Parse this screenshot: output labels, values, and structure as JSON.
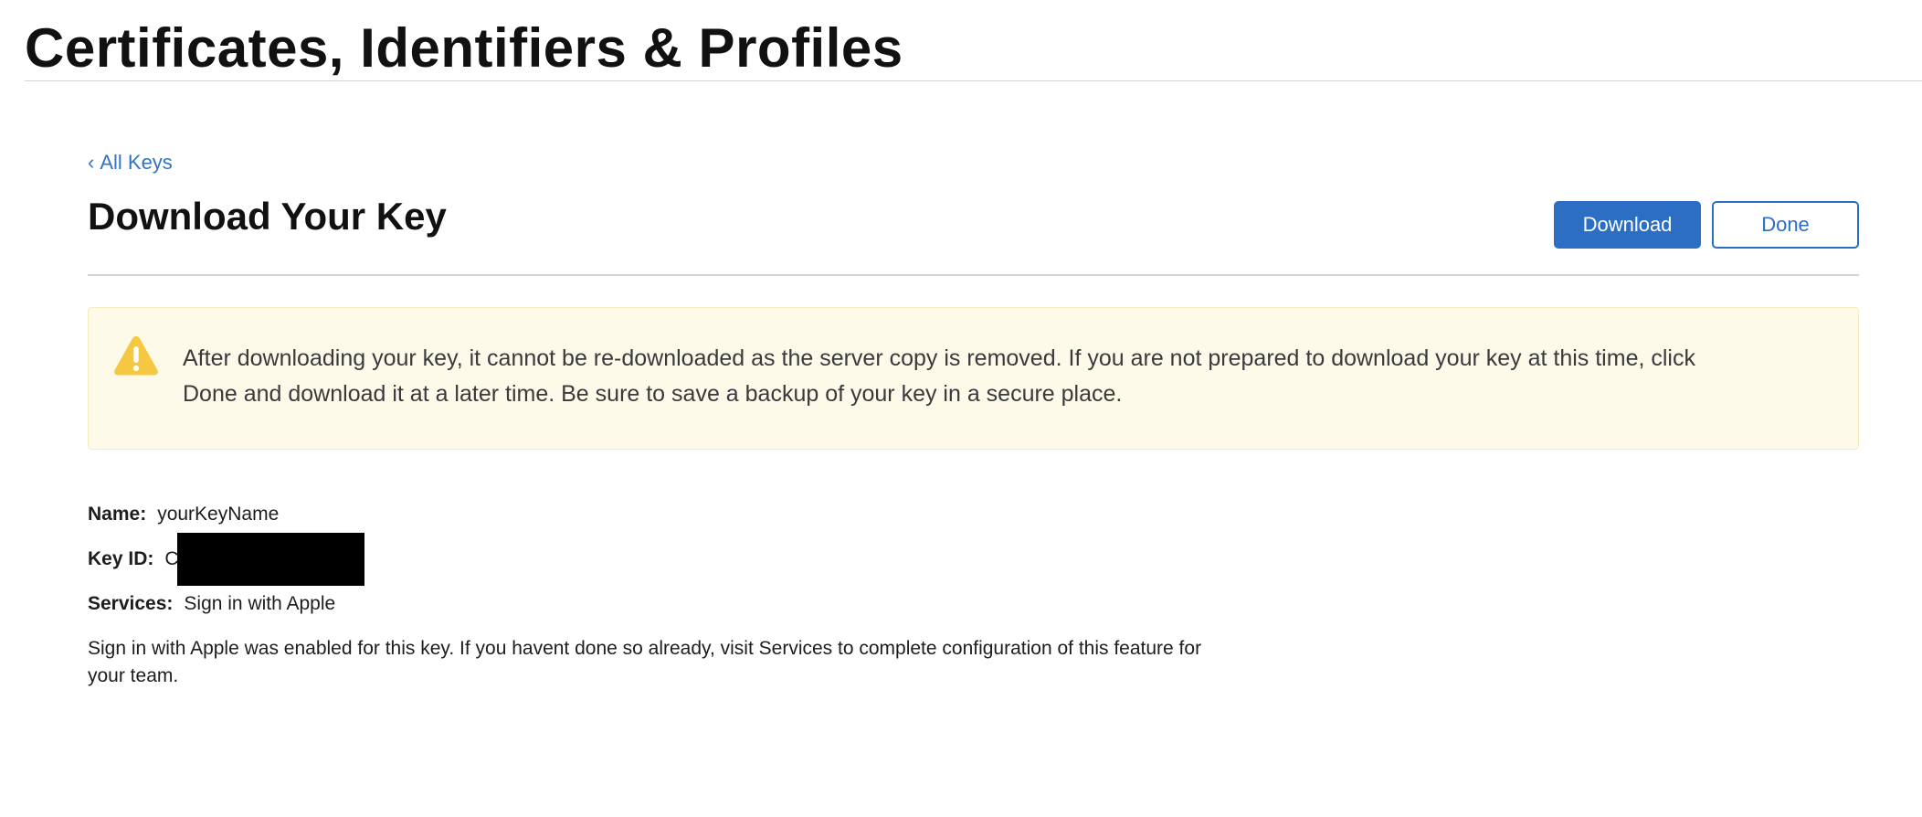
{
  "header": {
    "title": "Certificates, Identifiers & Profiles"
  },
  "nav": {
    "back_chevron": "‹",
    "back_label": "All Keys"
  },
  "page": {
    "title": "Download Your Key"
  },
  "actions": {
    "download_label": "Download",
    "done_label": "Done"
  },
  "warning": {
    "icon": "warning-triangle-icon",
    "text": "After downloading your key, it cannot be re-downloaded as the server copy is removed. If you are not prepared to download your key at this time, click Done and download it at a later time. Be sure to save a backup of your key in a secure place."
  },
  "details": {
    "name_label": "Name:",
    "name_value": "yourKeyName",
    "key_id_label": "Key ID:",
    "key_id_partial": "C",
    "services_label": "Services:",
    "services_value": "Sign in with Apple",
    "note": "Sign in with Apple was enabled for this key. If you havent done so already, visit Services to complete configuration of this feature for your team."
  },
  "colors": {
    "accent": "#2c6ec4",
    "link": "#3373c4",
    "warning_bg": "#fdfaea",
    "warning_icon": "#f5c842"
  }
}
